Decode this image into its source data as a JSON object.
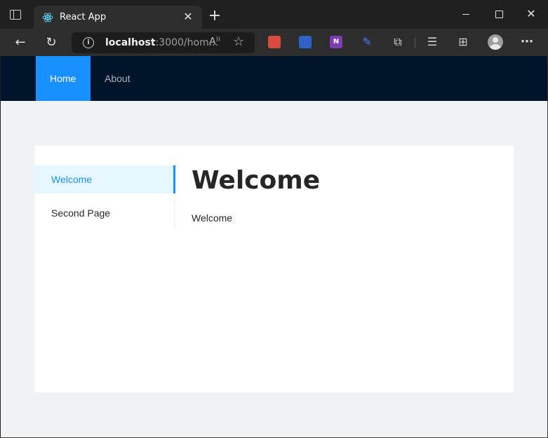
{
  "browser": {
    "tab_title": "React App",
    "url_host": "localhost",
    "url_rest": ":3000/hom...",
    "extensions": [
      "extension-red-icon",
      "extension-blue-shield-icon",
      "onenote-icon",
      "pen-icon",
      "puzzle-icon"
    ],
    "onenote_glyph": "N"
  },
  "app": {
    "nav": [
      {
        "label": "Home",
        "active": true
      },
      {
        "label": "About",
        "active": false
      }
    ],
    "sider": [
      {
        "label": "Welcome",
        "selected": true
      },
      {
        "label": "Second Page",
        "selected": false
      }
    ],
    "content": {
      "heading": "Welcome",
      "body": "Welcome"
    },
    "colors": {
      "header_bg": "#001529",
      "accent": "#1890ff",
      "selected_bg": "#e6f7ff",
      "layout_bg": "#f0f2f5"
    }
  }
}
